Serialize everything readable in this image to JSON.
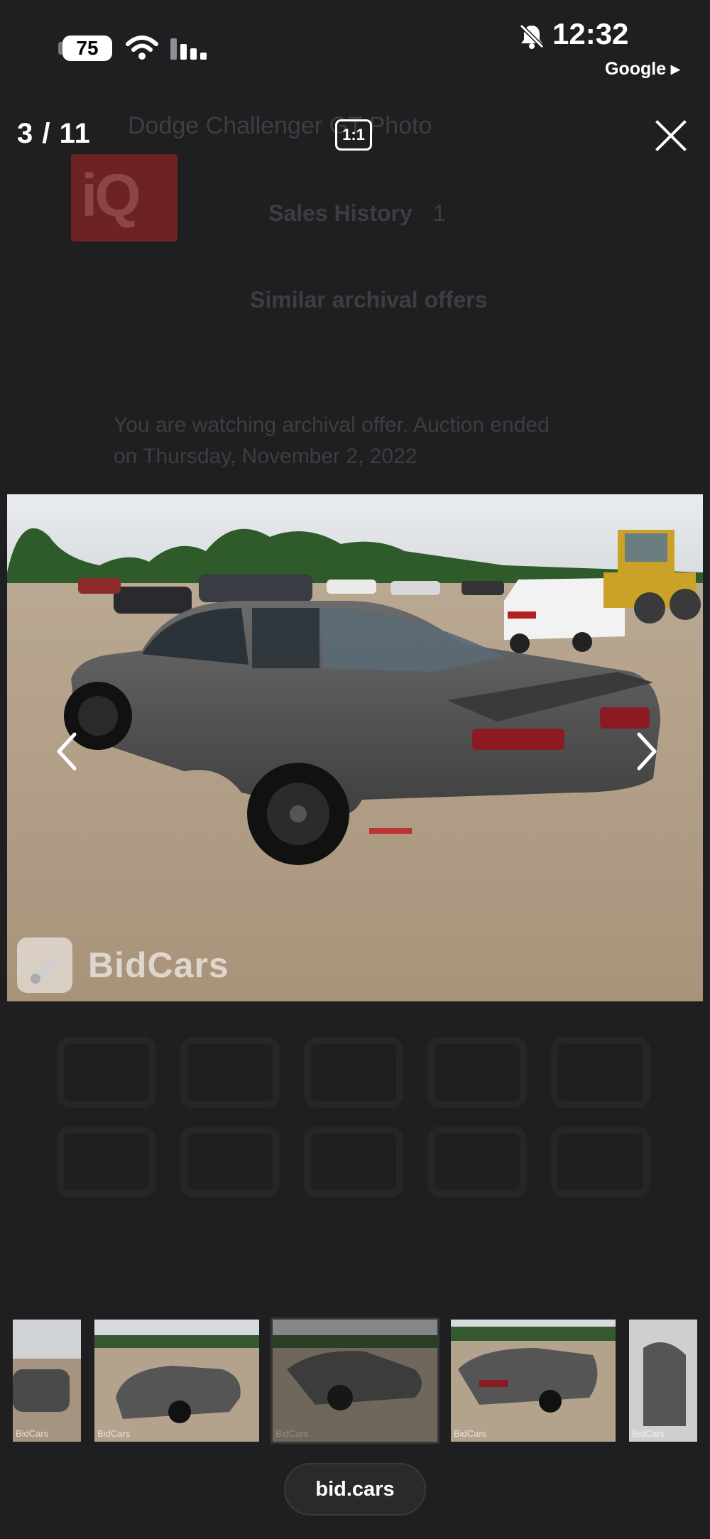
{
  "status_bar": {
    "battery": "75",
    "time": "12:32",
    "back_app": "Google ▸"
  },
  "background_page": {
    "header_text": "Dodge Challenger GT  Photo",
    "logo": "iQ",
    "sales_history_label": "Sales History",
    "sales_history_count": "1",
    "similar_offers_label": "Similar archival offers",
    "archival_notice": "You are watching archival offer. Auction ended",
    "archival_date": "on Thursday, November 2, 2022"
  },
  "lightbox": {
    "counter": "3 / 11",
    "ratio_button": "1:1",
    "watermark": "BidCars"
  },
  "thumbnails": [
    {
      "name": "thumb-1",
      "wm": "BidCars"
    },
    {
      "name": "thumb-2",
      "wm": "BidCars"
    },
    {
      "name": "thumb-3",
      "wm": "BidCars",
      "active": true
    },
    {
      "name": "thumb-4",
      "wm": "BidCars"
    },
    {
      "name": "thumb-5",
      "wm": "BidCars"
    }
  ],
  "browser": {
    "url": "bid.cars"
  }
}
